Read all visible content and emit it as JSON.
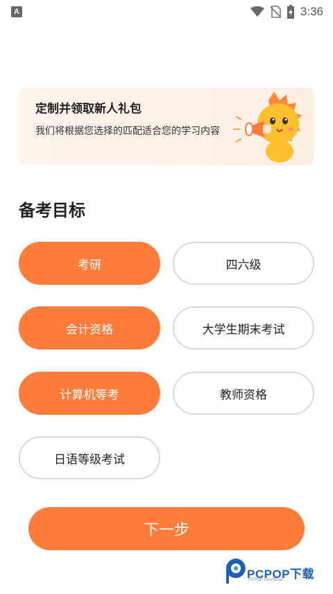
{
  "status_bar": {
    "time": "3:36",
    "app_badge": "A"
  },
  "banner": {
    "title": "定制并领取新人礼包",
    "description": "我们将根据您选择的匹配适合您的学习内容"
  },
  "section": {
    "title": "备考目标"
  },
  "options": [
    {
      "label": "考研",
      "selected": true
    },
    {
      "label": "四六级",
      "selected": false
    },
    {
      "label": "会计资格",
      "selected": true
    },
    {
      "label": "大学生期末考试",
      "selected": false
    },
    {
      "label": "计算机等考",
      "selected": true
    },
    {
      "label": "教师资格",
      "selected": false
    },
    {
      "label": "日语等级考试",
      "selected": false
    }
  ],
  "next_button": {
    "label": "下一步"
  },
  "watermark": {
    "text": "PCPOP下载",
    "subtext": "PCPOP Download"
  },
  "colors": {
    "accent": "#ff7c3a",
    "pill_border": "#d9d9d9",
    "banner_bg": "#fdf2e8"
  }
}
